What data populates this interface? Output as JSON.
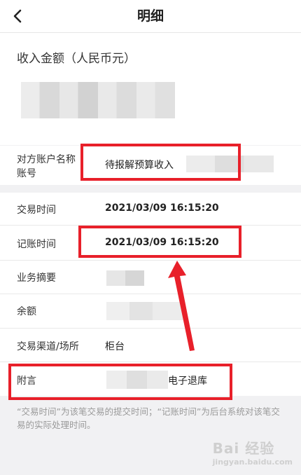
{
  "header": {
    "title": "明细"
  },
  "amount": {
    "label": "收入金额（人民币元）"
  },
  "counterparty": {
    "label_line1": "对方账户名称",
    "label_line2": "账号",
    "value": "待报解预算收入"
  },
  "details": {
    "trade_time_label": "交易时间",
    "trade_time_value": "2021/03/09  16:15:20",
    "post_time_label": "记账时间",
    "post_time_value": "2021/03/09  16:15:20",
    "summary_label": "业务摘要",
    "balance_label": "余额",
    "channel_label": "交易渠道/场所",
    "channel_value": "柜台",
    "remark_label": "附言",
    "remark_value": "电子退库"
  },
  "note": "“交易时间”为该笔交易的提交时间；“记账时间”为后台系统对该笔交易的实际处理时间。",
  "watermark": {
    "text": "Bai 经验",
    "sub": "jingyan.baidu.com"
  },
  "colors": {
    "annotation_red": "#e8202a",
    "background": "#f1f1f3"
  }
}
